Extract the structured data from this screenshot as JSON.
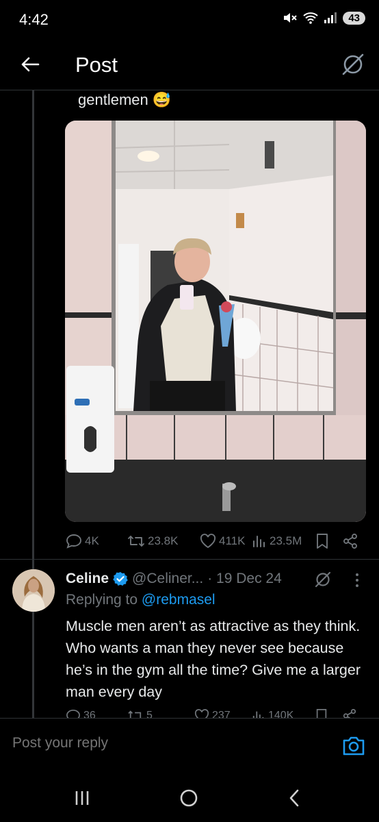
{
  "status_bar": {
    "time": "4:42",
    "battery": "43",
    "icons": [
      "mute-icon",
      "wifi-icon",
      "signal-icon"
    ]
  },
  "header": {
    "title": "Post",
    "back_icon": "arrow-left-icon",
    "grok_icon": "grok-icon"
  },
  "tweet": {
    "text": "gentlemen 😅",
    "image_alt": "Mirror selfie in a pink-tiled restroom, man in black puffer jacket holding flowers",
    "actions": {
      "replies": "4K",
      "reposts": "23.8K",
      "likes": "411K",
      "views": "23.5M"
    }
  },
  "reply": {
    "name": "Celine",
    "handle": "@Celiner...",
    "date": "· 19 Dec 24",
    "replying_prefix": "Replying to ",
    "replying_handle": "@rebmasel",
    "body": "Muscle men aren’t as attractive as they think. Who wants a man they never see because he’s in the gym all the time? Give me a larger man every day",
    "actions": {
      "replies": "36",
      "reposts": "5",
      "likes": "237",
      "views": "140K"
    }
  },
  "compose": {
    "placeholder": "Post your reply"
  },
  "colors": {
    "background": "#000000",
    "text": "#e7e9ea",
    "muted": "#71767b",
    "accent": "#1d9bf0"
  }
}
